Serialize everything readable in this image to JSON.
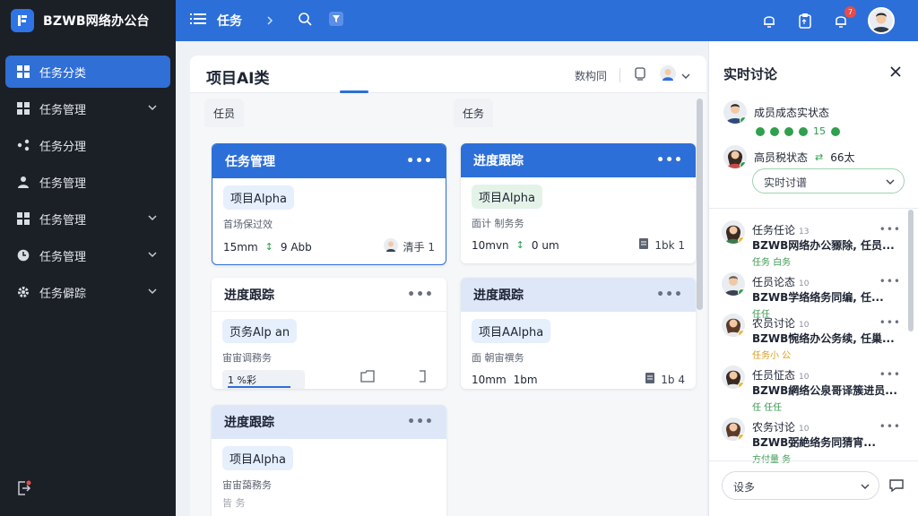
{
  "app": {
    "brand": "BZWB网络办公台",
    "brand_color": "#2d6fd8"
  },
  "sidebar": {
    "items": [
      {
        "label": "任务分类",
        "icon": "grid-icon",
        "active": true,
        "chevron": false
      },
      {
        "label": "任务管理",
        "icon": "grid-icon",
        "active": false,
        "chevron": true
      },
      {
        "label": "任务分理",
        "icon": "share-icon",
        "active": false,
        "chevron": false
      },
      {
        "label": "任务管理",
        "icon": "user-icon",
        "active": false,
        "chevron": false
      },
      {
        "label": "任务管理",
        "icon": "grid-icon",
        "active": false,
        "chevron": true
      },
      {
        "label": "任务管理",
        "icon": "clock-icon",
        "active": false,
        "chevron": true
      },
      {
        "label": "任务僻踪",
        "icon": "gear-icon",
        "active": false,
        "chevron": true
      }
    ]
  },
  "header": {
    "breadcrumb": "任务",
    "notification_count": "7"
  },
  "board": {
    "title": "项目AI类",
    "tool_label": "数构同",
    "columns": [
      {
        "tab": "任员"
      },
      {
        "tab": "任务"
      }
    ],
    "cards": [
      {
        "title": "任务管理",
        "chip": "项目Alpha",
        "sub": "首场保过效",
        "meta_left_a": "15mm",
        "meta_left_b": "9 Abb",
        "meta_right": "清手 1"
      },
      {
        "title": "进度跟踪",
        "chip": "项目Alpha",
        "sub": "面计 制务务",
        "meta_left_a": "10mvn",
        "meta_left_b": "0 um",
        "meta_right": "1bk 1"
      },
      {
        "title": "进度跟踪",
        "chip": "页务Alp an",
        "sub": "宙宙调務务",
        "progress_text": "1 %彩"
      },
      {
        "title": "进度跟踪",
        "chip": "项目AAlpha",
        "sub": "面 朝宙禩务",
        "meta_left_a": "10mm",
        "meta_left_b": "1bm",
        "meta_right": "1b 4"
      },
      {
        "title": "进度跟踪",
        "chip": "项目Alpha",
        "sub": "宙宙藹務务",
        "footer_text": "皆 务"
      }
    ]
  },
  "panel": {
    "title": "实时讨论",
    "member1": "成员成态实状态",
    "member1_count": "15",
    "member2": "高员税状态",
    "member2_tail": "66太",
    "select_label": "实时讨谱",
    "messages": [
      {
        "name": "任务任论",
        "time": "13",
        "text": "BZWB网络办公豲除, 任员...",
        "tags": "任务  白务"
      },
      {
        "name": "任员论态",
        "time": "10",
        "text": "BZWB学络络务同编, 任...",
        "tags": "任任"
      },
      {
        "name": "农员讨论",
        "time": "10",
        "text": "BZWB惋络办公务续, 任巢...",
        "tags": "任务小 公"
      },
      {
        "name": "任员怔态",
        "time": "10",
        "text": "BZWB網络公泉哥译簇进员...",
        "tags": "任  任任"
      },
      {
        "name": "农务讨论",
        "time": "10",
        "text": "BZWB弼絶络务同猜宵...",
        "tags": "方付量 务"
      }
    ],
    "bottom_select": "设多"
  }
}
